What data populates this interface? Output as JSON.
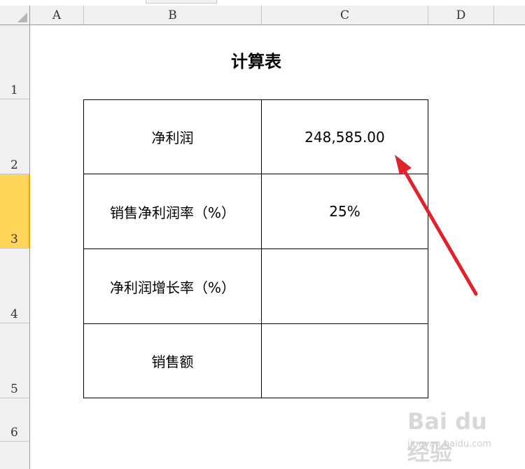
{
  "columns": [
    "A",
    "B",
    "C",
    "D"
  ],
  "rows": [
    "1",
    "2",
    "3",
    "4",
    "5",
    "6"
  ],
  "selected_row": "3",
  "sheet": {
    "title": "计算表",
    "table": [
      {
        "label": "净利润",
        "value": "248,585.00"
      },
      {
        "label": "销售净利润率（%）",
        "value": "25%"
      },
      {
        "label": "净利润增长率（%）",
        "value": ""
      },
      {
        "label": "销售额",
        "value": ""
      }
    ]
  },
  "annotation": {
    "arrow_color": "#e0222d"
  },
  "watermark": {
    "logo": "Bai du 经验",
    "url": "jingyan.baidu.com"
  },
  "colors": {
    "header_bg": "#f0f0f0",
    "selected_row_bg": "#ffd55a"
  }
}
